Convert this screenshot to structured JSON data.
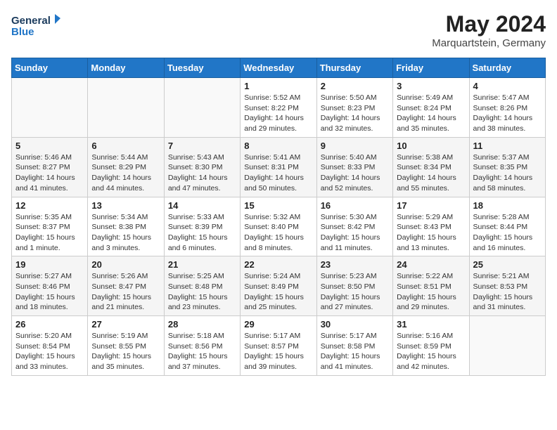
{
  "header": {
    "logo_line1": "General",
    "logo_line2": "Blue",
    "month_title": "May 2024",
    "location": "Marquartstein, Germany"
  },
  "columns": [
    "Sunday",
    "Monday",
    "Tuesday",
    "Wednesday",
    "Thursday",
    "Friday",
    "Saturday"
  ],
  "weeks": [
    [
      {
        "day": "",
        "info": ""
      },
      {
        "day": "",
        "info": ""
      },
      {
        "day": "",
        "info": ""
      },
      {
        "day": "1",
        "info": "Sunrise: 5:52 AM\nSunset: 8:22 PM\nDaylight: 14 hours and 29 minutes."
      },
      {
        "day": "2",
        "info": "Sunrise: 5:50 AM\nSunset: 8:23 PM\nDaylight: 14 hours and 32 minutes."
      },
      {
        "day": "3",
        "info": "Sunrise: 5:49 AM\nSunset: 8:24 PM\nDaylight: 14 hours and 35 minutes."
      },
      {
        "day": "4",
        "info": "Sunrise: 5:47 AM\nSunset: 8:26 PM\nDaylight: 14 hours and 38 minutes."
      }
    ],
    [
      {
        "day": "5",
        "info": "Sunrise: 5:46 AM\nSunset: 8:27 PM\nDaylight: 14 hours and 41 minutes."
      },
      {
        "day": "6",
        "info": "Sunrise: 5:44 AM\nSunset: 8:29 PM\nDaylight: 14 hours and 44 minutes."
      },
      {
        "day": "7",
        "info": "Sunrise: 5:43 AM\nSunset: 8:30 PM\nDaylight: 14 hours and 47 minutes."
      },
      {
        "day": "8",
        "info": "Sunrise: 5:41 AM\nSunset: 8:31 PM\nDaylight: 14 hours and 50 minutes."
      },
      {
        "day": "9",
        "info": "Sunrise: 5:40 AM\nSunset: 8:33 PM\nDaylight: 14 hours and 52 minutes."
      },
      {
        "day": "10",
        "info": "Sunrise: 5:38 AM\nSunset: 8:34 PM\nDaylight: 14 hours and 55 minutes."
      },
      {
        "day": "11",
        "info": "Sunrise: 5:37 AM\nSunset: 8:35 PM\nDaylight: 14 hours and 58 minutes."
      }
    ],
    [
      {
        "day": "12",
        "info": "Sunrise: 5:35 AM\nSunset: 8:37 PM\nDaylight: 15 hours and 1 minute."
      },
      {
        "day": "13",
        "info": "Sunrise: 5:34 AM\nSunset: 8:38 PM\nDaylight: 15 hours and 3 minutes."
      },
      {
        "day": "14",
        "info": "Sunrise: 5:33 AM\nSunset: 8:39 PM\nDaylight: 15 hours and 6 minutes."
      },
      {
        "day": "15",
        "info": "Sunrise: 5:32 AM\nSunset: 8:40 PM\nDaylight: 15 hours and 8 minutes."
      },
      {
        "day": "16",
        "info": "Sunrise: 5:30 AM\nSunset: 8:42 PM\nDaylight: 15 hours and 11 minutes."
      },
      {
        "day": "17",
        "info": "Sunrise: 5:29 AM\nSunset: 8:43 PM\nDaylight: 15 hours and 13 minutes."
      },
      {
        "day": "18",
        "info": "Sunrise: 5:28 AM\nSunset: 8:44 PM\nDaylight: 15 hours and 16 minutes."
      }
    ],
    [
      {
        "day": "19",
        "info": "Sunrise: 5:27 AM\nSunset: 8:46 PM\nDaylight: 15 hours and 18 minutes."
      },
      {
        "day": "20",
        "info": "Sunrise: 5:26 AM\nSunset: 8:47 PM\nDaylight: 15 hours and 21 minutes."
      },
      {
        "day": "21",
        "info": "Sunrise: 5:25 AM\nSunset: 8:48 PM\nDaylight: 15 hours and 23 minutes."
      },
      {
        "day": "22",
        "info": "Sunrise: 5:24 AM\nSunset: 8:49 PM\nDaylight: 15 hours and 25 minutes."
      },
      {
        "day": "23",
        "info": "Sunrise: 5:23 AM\nSunset: 8:50 PM\nDaylight: 15 hours and 27 minutes."
      },
      {
        "day": "24",
        "info": "Sunrise: 5:22 AM\nSunset: 8:51 PM\nDaylight: 15 hours and 29 minutes."
      },
      {
        "day": "25",
        "info": "Sunrise: 5:21 AM\nSunset: 8:53 PM\nDaylight: 15 hours and 31 minutes."
      }
    ],
    [
      {
        "day": "26",
        "info": "Sunrise: 5:20 AM\nSunset: 8:54 PM\nDaylight: 15 hours and 33 minutes."
      },
      {
        "day": "27",
        "info": "Sunrise: 5:19 AM\nSunset: 8:55 PM\nDaylight: 15 hours and 35 minutes."
      },
      {
        "day": "28",
        "info": "Sunrise: 5:18 AM\nSunset: 8:56 PM\nDaylight: 15 hours and 37 minutes."
      },
      {
        "day": "29",
        "info": "Sunrise: 5:17 AM\nSunset: 8:57 PM\nDaylight: 15 hours and 39 minutes."
      },
      {
        "day": "30",
        "info": "Sunrise: 5:17 AM\nSunset: 8:58 PM\nDaylight: 15 hours and 41 minutes."
      },
      {
        "day": "31",
        "info": "Sunrise: 5:16 AM\nSunset: 8:59 PM\nDaylight: 15 hours and 42 minutes."
      },
      {
        "day": "",
        "info": ""
      }
    ]
  ]
}
